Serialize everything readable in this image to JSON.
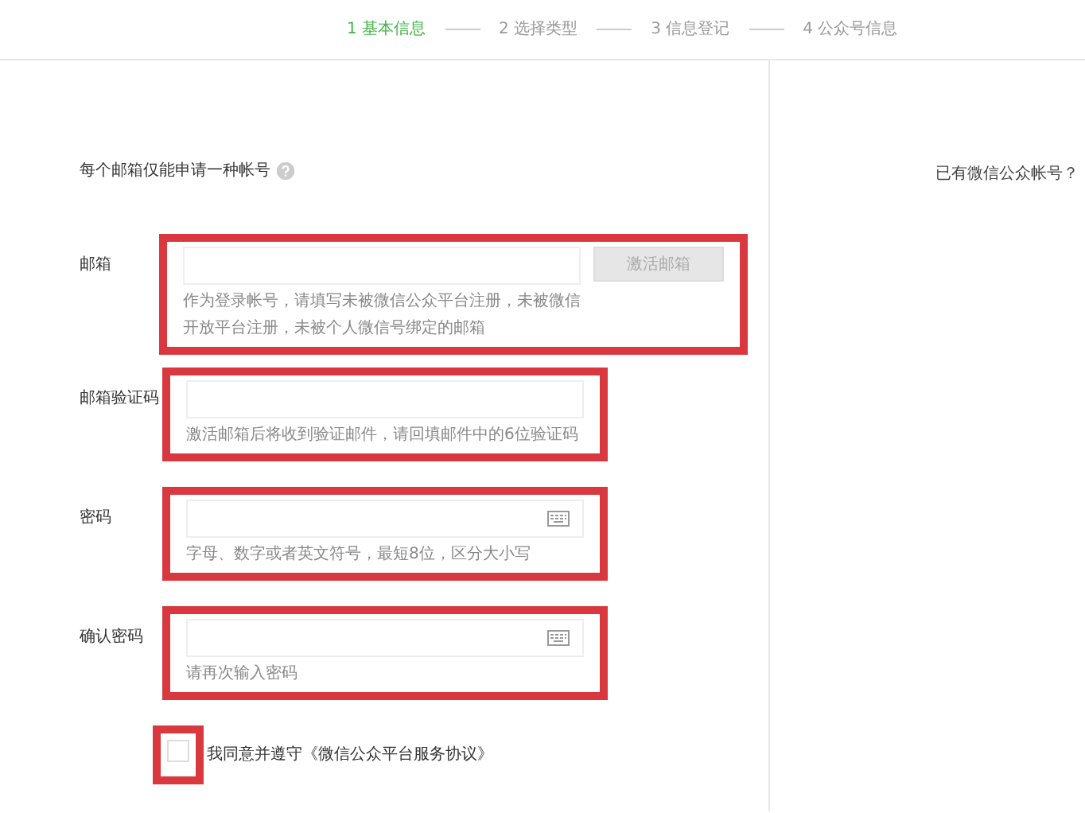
{
  "steps": [
    {
      "label": "1 基本信息",
      "selected": true
    },
    {
      "label": "2 选择类型",
      "selected": false
    },
    {
      "label": "3 信息登记",
      "selected": false
    },
    {
      "label": "4 公众号信息",
      "selected": false
    }
  ],
  "notice": "每个邮箱仅能申请一种帐号",
  "fields": [
    {
      "label": "邮箱",
      "kind": "email",
      "button": "激活邮箱",
      "hint": "作为登录帐号，请填写未被微信公众平台注册，未被微信开放平台注册，未被个人微信号绑定的邮箱",
      "highlighted": true
    },
    {
      "label": "邮箱验证码",
      "kind": "code",
      "hint": "激活邮箱后将收到验证邮件，请回填邮件中的6位验证码",
      "highlighted": true
    },
    {
      "label": "密码",
      "kind": "password",
      "hint": "字母、数字或者英文符号，最短8位，区分大小写",
      "highlighted": true
    },
    {
      "label": "确认密码",
      "kind": "password",
      "hint": "请再次输入密码",
      "highlighted": true
    }
  ],
  "agreement": {
    "text": "我同意并遵守《微信公众平台服务协议》",
    "checked": false,
    "highlighted": true
  },
  "side": {
    "text": "已有微信公众帐号？"
  }
}
